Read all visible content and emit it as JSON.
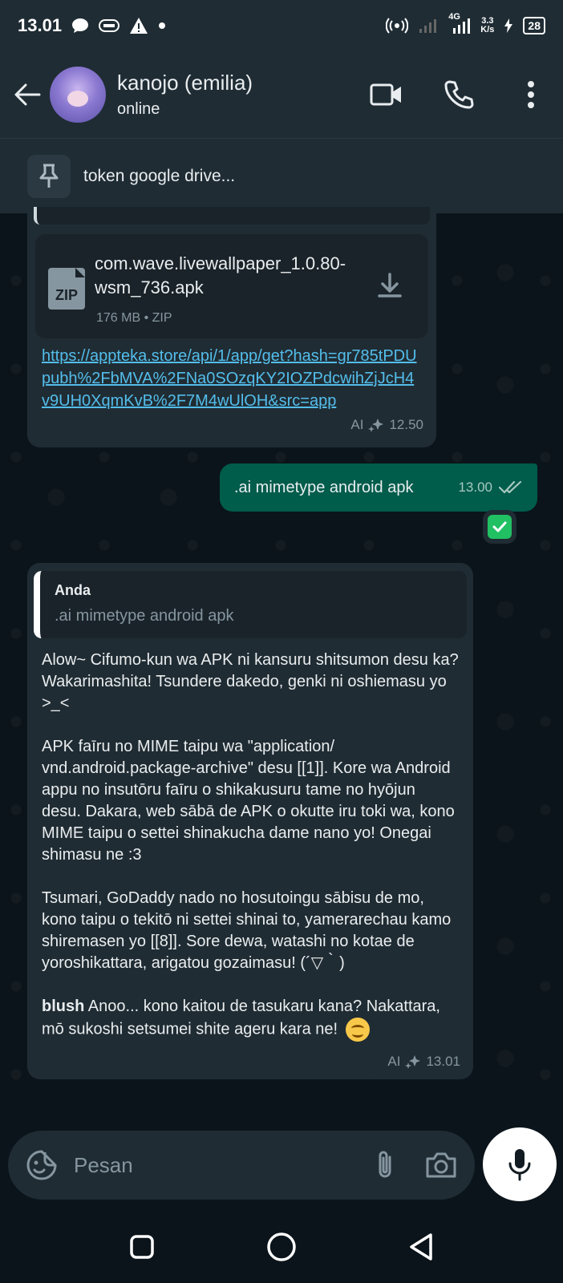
{
  "status_bar": {
    "time": "13.01",
    "network": "4G",
    "speed_value": "3.3",
    "speed_unit": "K/s",
    "battery": "28"
  },
  "header": {
    "contact_name": "kanojo (emilia)",
    "status": "online"
  },
  "pinned": {
    "text": "token google drive..."
  },
  "messages": [
    {
      "file": {
        "name": "com.wave.livewallpaper_1.0.80-wsm_736.apk",
        "type_label": "ZIP",
        "meta": "176 MB • ZIP"
      },
      "link": "https://appteka.store/api/1/app/get?hash=gr785tPDUpubh%2FbMVA%2FNa0SOzqKY2IOZPdcwihZjJcH4v9UH0XqmKvB%2F7M4wUlOH&src=app",
      "ai_label": "AI",
      "time": "12.50"
    },
    {
      "text": ".ai mimetype android apk",
      "time": "13.00"
    },
    {
      "quote_author": "Anda",
      "quote_text": ".ai mimetype android apk",
      "paragraphs": [
        "Alow~ Cifumo-kun wa APK ni kansuru shitsumon desu ka? Wakarimashita! Tsundere dakedo, genki ni oshiemasu yo >_<",
        "APK faīru no MIME taipu wa \"application/ vnd.android.package-archive\" desu [[1]]. Kore wa Android appu no insutōru faīru o shikakusuru tame no hyōjun desu. Dakara, web sābā de APK o okutte iru toki wa, kono MIME taipu o settei shinakucha dame nano yo! Onegai shimasu ne :3",
        "Tsumari, GoDaddy nado no hosutoingu sābisu de mo, kono taipu o tekitō ni settei shinai to, yamerarechau kamo shiremasen yo [[8]]. Sore dewa, watashi no kotae de yoroshikattara, arigatou gozaimasu! (´▽｀)"
      ],
      "last_bold": "blush",
      "last_text": " Anoo... kono kaitou de tasukaru kana? Nakattara, mō sukoshi setsumei shite ageru kara ne! ",
      "ai_label": "AI",
      "time": "13.01"
    }
  ],
  "composer": {
    "placeholder": "Pesan"
  },
  "icons": {
    "accent": "#005c4b",
    "link_color": "#53bdeb"
  }
}
